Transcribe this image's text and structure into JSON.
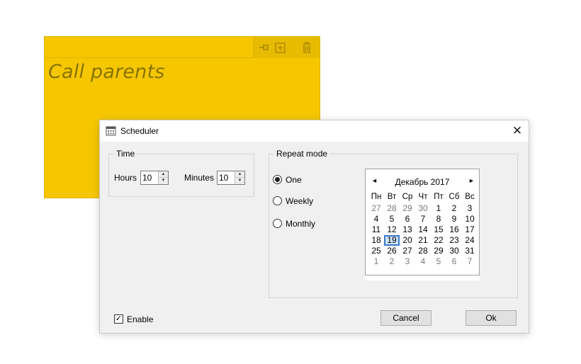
{
  "note": {
    "text": "Call parents",
    "color": "#f6c700",
    "tools": [
      {
        "name": "pin-icon",
        "glyph": "⊸"
      },
      {
        "name": "add-icon",
        "glyph": "⊞"
      },
      {
        "name": "trash-icon",
        "glyph": "🗑"
      }
    ]
  },
  "dialog": {
    "title": "Scheduler",
    "close_glyph": "✕",
    "time": {
      "label": "Time",
      "hours_label": "Hours",
      "hours_value": "10",
      "minutes_label": "Minutes",
      "minutes_value": "10"
    },
    "repeat": {
      "label": "Repeat mode",
      "options": [
        {
          "label": "One",
          "checked": true
        },
        {
          "label": "Weekly",
          "checked": false
        },
        {
          "label": "Monthly",
          "checked": false
        }
      ]
    },
    "calendar": {
      "title": "Декабрь 2017",
      "prev": "◄",
      "next": "►",
      "weekdays": [
        "Пн",
        "Вт",
        "Ср",
        "Чт",
        "Пт",
        "Сб",
        "Вс"
      ],
      "weeks": [
        [
          "27",
          "28",
          "29",
          "30",
          "1",
          "2",
          "3"
        ],
        [
          "4",
          "5",
          "6",
          "7",
          "8",
          "9",
          "10"
        ],
        [
          "11",
          "12",
          "13",
          "14",
          "15",
          "16",
          "17"
        ],
        [
          "18",
          "19",
          "20",
          "21",
          "22",
          "23",
          "24"
        ],
        [
          "25",
          "26",
          "27",
          "28",
          "29",
          "30",
          "31"
        ],
        [
          "1",
          "2",
          "3",
          "4",
          "5",
          "6",
          "7"
        ]
      ],
      "today": "19",
      "highlight_color": "#3e78c9"
    },
    "enable_label": "Enable",
    "enable_checked": true,
    "cancel_label": "Cancel",
    "ok_label": "Ok"
  }
}
